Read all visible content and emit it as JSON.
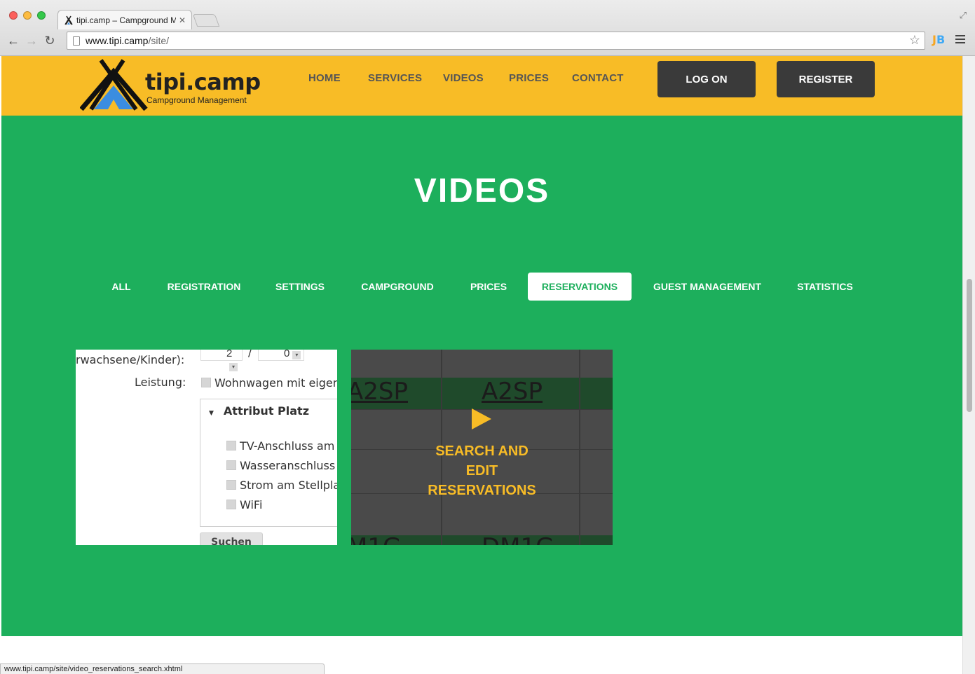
{
  "browser": {
    "tab_title": "tipi.camp – Campground M",
    "url_host": "www.tipi.camp",
    "url_path": "/site/",
    "status_url": "www.tipi.camp/site/video_reservations_search.xhtml",
    "extension_label_j": "J",
    "extension_label_b": "B"
  },
  "header": {
    "logo_name": "tipi.camp",
    "logo_tagline": "Campground Management",
    "nav": [
      "HOME",
      "SERVICES",
      "VIDEOS",
      "PRICES",
      "CONTACT"
    ],
    "log_on": "LOG ON",
    "register": "REGISTER",
    "colors": {
      "header_bg": "#f8bc26",
      "section_bg": "#1daf5c",
      "button_bg": "#3a3a3a"
    }
  },
  "videos": {
    "title": "VIDEOS",
    "filters": [
      "ALL",
      "REGISTRATION",
      "SETTINGS",
      "CAMPGROUND",
      "PRICES",
      "RESERVATIONS",
      "GUEST MANAGEMENT",
      "STATISTICS"
    ],
    "active_filter": "RESERVATIONS",
    "thumb1": {
      "label_persons": "rwachsene/Kinder):",
      "adults": "2",
      "sep": "/",
      "kids": "0",
      "label_service": "Leistung:",
      "service_option": "Wohnwagen mit eigen",
      "group_title": "Attribut Platz",
      "options": [
        "TV-Anschluss am",
        "Wasseranschluss",
        "Strom am Stellpla",
        "WiFi"
      ],
      "search_button": "Suchen"
    },
    "thumb2": {
      "cell_left": "A2SP",
      "cell_right": "A2SP",
      "cell_bottom_left": "M1G",
      "cell_bottom_right": "DM1G",
      "overlay_lines": [
        "SEARCH AND",
        "EDIT",
        "RESERVATIONS"
      ]
    }
  }
}
